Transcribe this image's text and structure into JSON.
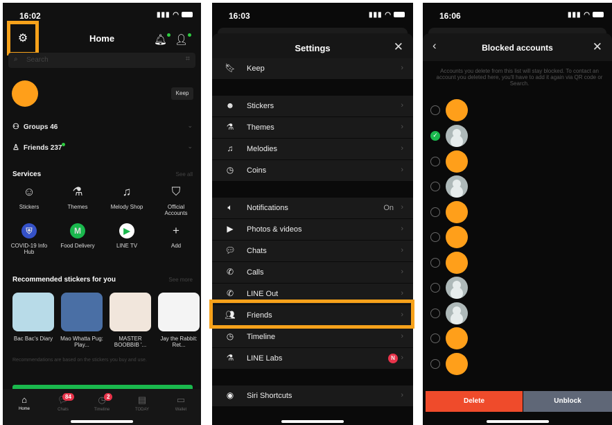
{
  "panel1": {
    "time": "16:02",
    "title": "Home",
    "search_placeholder": "Search",
    "keep_label": "Keep",
    "groups_label": "Groups 46",
    "friends_label": "Friends 237",
    "services_title": "Services",
    "see_all": "See all",
    "services": [
      {
        "label": "Stickers",
        "icon": "smile-icon"
      },
      {
        "label": "Themes",
        "icon": "flask-icon"
      },
      {
        "label": "Melody Shop",
        "icon": "music-icon"
      },
      {
        "label": "Official Accounts",
        "icon": "shield-icon"
      },
      {
        "label": "COVID-19 Info Hub",
        "icon": "covid-icon"
      },
      {
        "label": "Food Delivery",
        "icon": "food-icon"
      },
      {
        "label": "LINE TV",
        "icon": "play-icon"
      },
      {
        "label": "Add",
        "icon": "plus-icon"
      }
    ],
    "recommended_title": "Recommended stickers for you",
    "see_more": "See more",
    "stickers": [
      {
        "label": "Bac Bac's Diary"
      },
      {
        "label": "Mao Whatta Pug: Play..."
      },
      {
        "label": "MASTER BOOBBIB '..."
      },
      {
        "label": "Jay the Rabbit: Ret..."
      }
    ],
    "rec_note": "Recommendations are based on the stickers you buy and use.",
    "tabs": [
      {
        "label": "Home",
        "icon": "home-icon"
      },
      {
        "label": "Chats",
        "icon": "chat-icon",
        "badge": "84"
      },
      {
        "label": "Timeline",
        "icon": "clock-icon",
        "badge": "2"
      },
      {
        "label": "TODAY",
        "icon": "news-icon"
      },
      {
        "label": "Wallet",
        "icon": "wallet-icon"
      }
    ]
  },
  "panel2": {
    "time": "16:03",
    "title": "Settings",
    "rows": [
      {
        "label": "Keep",
        "icon": "bookmark-icon"
      },
      {
        "label": "Stickers",
        "icon": "smile-icon"
      },
      {
        "label": "Themes",
        "icon": "flask-icon"
      },
      {
        "label": "Melodies",
        "icon": "music-icon"
      },
      {
        "label": "Coins",
        "icon": "clock-icon"
      },
      {
        "label": "Notifications",
        "icon": "speaker-icon",
        "value": "On"
      },
      {
        "label": "Photos & videos",
        "icon": "play-icon"
      },
      {
        "label": "Chats",
        "icon": "chat-icon"
      },
      {
        "label": "Calls",
        "icon": "phone-icon"
      },
      {
        "label": "LINE Out",
        "icon": "phone-out-icon"
      },
      {
        "label": "Friends",
        "icon": "friends-icon"
      },
      {
        "label": "Timeline",
        "icon": "clock-icon"
      },
      {
        "label": "LINE Labs",
        "icon": "flask-icon",
        "badge": "N"
      },
      {
        "label": "Siri Shortcuts",
        "icon": "siri-icon"
      }
    ]
  },
  "panel3": {
    "time": "16:06",
    "title": "Blocked accounts",
    "note": "Accounts you delete from this list will stay blocked. To contact an account you deleted here, you'll have to add it again via QR code or Search.",
    "accounts": [
      {
        "selected": false,
        "avatar": "orange"
      },
      {
        "selected": true,
        "avatar": "gray"
      },
      {
        "selected": false,
        "avatar": "orange"
      },
      {
        "selected": false,
        "avatar": "gray"
      },
      {
        "selected": false,
        "avatar": "orange"
      },
      {
        "selected": false,
        "avatar": "orange"
      },
      {
        "selected": false,
        "avatar": "orange"
      },
      {
        "selected": false,
        "avatar": "gray"
      },
      {
        "selected": false,
        "avatar": "gray"
      },
      {
        "selected": false,
        "avatar": "orange"
      },
      {
        "selected": false,
        "avatar": "orange"
      }
    ],
    "delete_label": "Delete",
    "unblock_label": "Unblock"
  },
  "colors": {
    "highlight": "#f7a21b",
    "line_green": "#1ab84d",
    "delete_red": "#ef4b2b",
    "unblock_gray": "#5f6777"
  }
}
